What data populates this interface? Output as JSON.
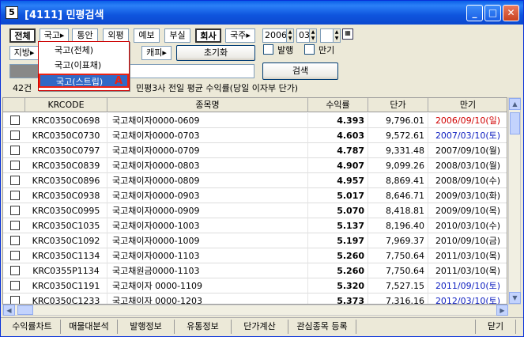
{
  "window": {
    "title": "[4111] 민평검색",
    "app_icon": "5"
  },
  "toolbar1": {
    "filters": [
      "전체",
      "국고▸",
      "통안",
      "외평",
      "예보",
      "부실",
      "회사",
      "국주▸"
    ],
    "selected": "전체",
    "year": "2006",
    "month": "03",
    "day": ""
  },
  "toolbar2": {
    "region": "지방▸",
    "capi": "캐피▸",
    "reset": "초기화",
    "checks": [
      "발행",
      "만기"
    ],
    "search": "검색"
  },
  "dropdown": {
    "items": [
      "국고(전체)",
      "국고(이표채)",
      "국고(스트립)"
    ],
    "highlighted_marker": "A"
  },
  "info": {
    "count": "42건",
    "desc": "민평3사 전일 평균 수익률(당일 이자부 단가)"
  },
  "grid": {
    "headers": [
      "KRCODE",
      "종목명",
      "수익률",
      "단가",
      "만기"
    ],
    "rows": [
      {
        "code": "KRC0350C0698",
        "name": "국고채이자0000-0609",
        "yield": "4.393",
        "price": "9,796.01",
        "maturity": "2006/09/10(일)",
        "color": "#d00000"
      },
      {
        "code": "KRC0350C0730",
        "name": "국고채이자0000-0703",
        "yield": "4.603",
        "price": "9,572.61",
        "maturity": "2007/03/10(토)",
        "color": "#1020c0"
      },
      {
        "code": "KRC0350C0797",
        "name": "국고채이자0000-0709",
        "yield": "4.787",
        "price": "9,331.48",
        "maturity": "2007/09/10(월)",
        "color": "#000000"
      },
      {
        "code": "KRC0350C0839",
        "name": "국고채이자0000-0803",
        "yield": "4.907",
        "price": "9,099.26",
        "maturity": "2008/03/10(월)",
        "color": "#000000"
      },
      {
        "code": "KRC0350C0896",
        "name": "국고채이자0000-0809",
        "yield": "4.957",
        "price": "8,869.41",
        "maturity": "2008/09/10(수)",
        "color": "#000000"
      },
      {
        "code": "KRC0350C0938",
        "name": "국고채이자0000-0903",
        "yield": "5.017",
        "price": "8,646.71",
        "maturity": "2009/03/10(화)",
        "color": "#000000"
      },
      {
        "code": "KRC0350C0995",
        "name": "국고채이자0000-0909",
        "yield": "5.070",
        "price": "8,418.81",
        "maturity": "2009/09/10(목)",
        "color": "#000000"
      },
      {
        "code": "KRC0350C1035",
        "name": "국고채이자0000-1003",
        "yield": "5.137",
        "price": "8,196.40",
        "maturity": "2010/03/10(수)",
        "color": "#000000"
      },
      {
        "code": "KRC0350C1092",
        "name": "국고채이자0000-1009",
        "yield": "5.197",
        "price": "7,969.37",
        "maturity": "2010/09/10(금)",
        "color": "#000000"
      },
      {
        "code": "KRC0350C1134",
        "name": "국고채이자0000-1103",
        "yield": "5.260",
        "price": "7,750.64",
        "maturity": "2011/03/10(목)",
        "color": "#000000"
      },
      {
        "code": "KRC0355P1134",
        "name": "국고채원금0000-1103",
        "yield": "5.260",
        "price": "7,750.64",
        "maturity": "2011/03/10(목)",
        "color": "#000000"
      },
      {
        "code": "KRC0350C1191",
        "name": "국고채이자 0000-1109",
        "yield": "5.320",
        "price": "7,527.15",
        "maturity": "2011/09/10(토)",
        "color": "#1020c0"
      },
      {
        "code": "KRC0350C1233",
        "name": "국고채이자 0000-1203",
        "yield": "5.373",
        "price": "7,316.16",
        "maturity": "2012/03/10(토)",
        "color": "#1020c0"
      }
    ]
  },
  "tabs": [
    "수익률차트",
    "매물대분석",
    "발행정보",
    "유통정보",
    "단가계산",
    "관심종목 등록",
    "닫기"
  ]
}
